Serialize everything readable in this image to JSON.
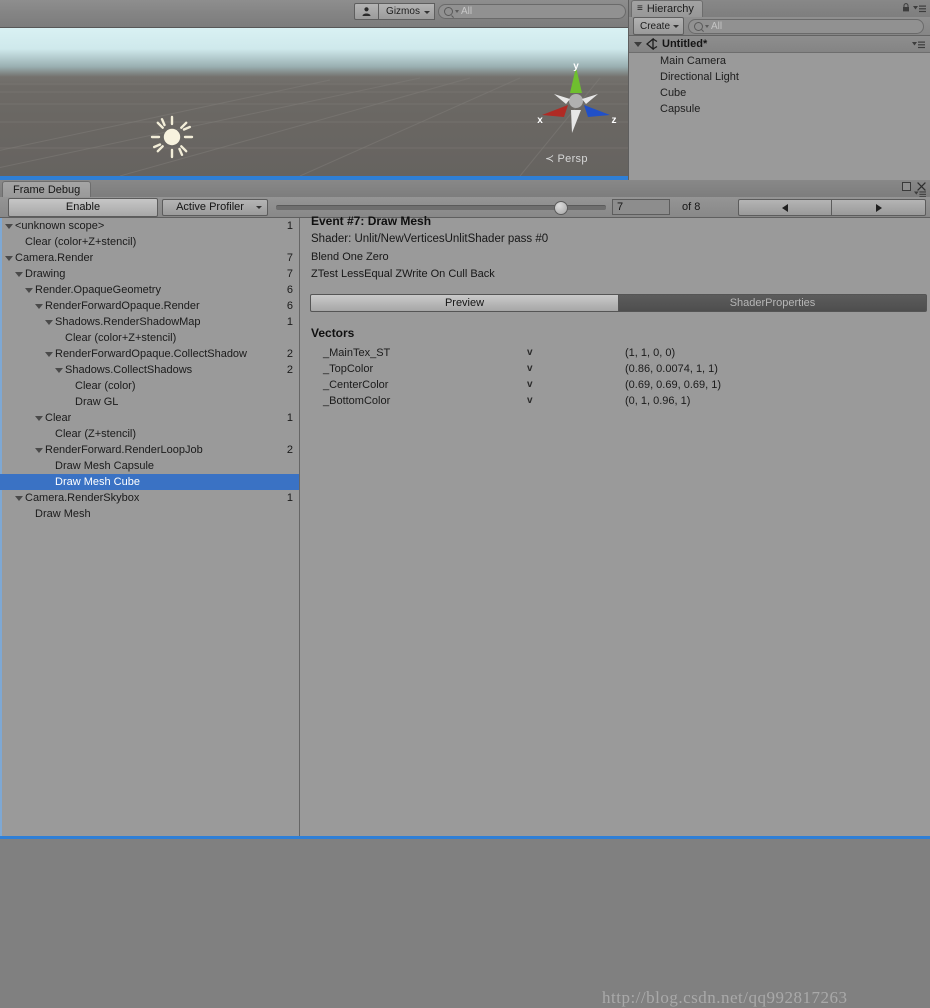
{
  "scene_view": {
    "toolbar": {
      "person_icon": "person-icon",
      "gizmos_label": "Gizmos",
      "search_placeholder": "All",
      "search_value": "All"
    },
    "gizmo": {
      "axis_x": "x",
      "axis_y": "y",
      "axis_z": "z",
      "projection_label": "Persp",
      "color_x": "#b02a24",
      "color_y": "#6fbf2f",
      "color_z": "#2050c8"
    },
    "light_icon": "sun-light-gizmo-icon"
  },
  "hierarchy": {
    "tab_label": "Hierarchy",
    "tab_icon": "hierarchy-icon",
    "create_label": "Create",
    "search_placeholder": "All",
    "search_value": "All",
    "scene_root": "Untitled*",
    "items": [
      {
        "label": "Main Camera"
      },
      {
        "label": "Directional Light"
      },
      {
        "label": "Cube"
      },
      {
        "label": "Capsule"
      }
    ]
  },
  "frame_debug": {
    "tab_label": "Frame Debug",
    "toolbar": {
      "enable_label": "Enable",
      "profiler_label": "Active Profiler",
      "event_number": "7",
      "of_label": "of 8",
      "slider_value": 7,
      "slider_max": 8
    },
    "tree": [
      {
        "label": "<unknown scope>",
        "indent": 0,
        "arrow": true,
        "count": "1",
        "selected": false
      },
      {
        "label": "Clear (color+Z+stencil)",
        "indent": 1,
        "arrow": false,
        "count": "",
        "selected": false
      },
      {
        "label": "Camera.Render",
        "indent": 0,
        "arrow": true,
        "count": "7",
        "selected": false
      },
      {
        "label": "Drawing",
        "indent": 1,
        "arrow": true,
        "count": "7",
        "selected": false
      },
      {
        "label": "Render.OpaqueGeometry",
        "indent": 2,
        "arrow": true,
        "count": "6",
        "selected": false
      },
      {
        "label": "RenderForwardOpaque.Render",
        "indent": 3,
        "arrow": true,
        "count": "6",
        "selected": false
      },
      {
        "label": "Shadows.RenderShadowMap",
        "indent": 4,
        "arrow": true,
        "count": "1",
        "selected": false
      },
      {
        "label": "Clear (color+Z+stencil)",
        "indent": 5,
        "arrow": false,
        "count": "",
        "selected": false
      },
      {
        "label": "RenderForwardOpaque.CollectShadow",
        "indent": 4,
        "arrow": true,
        "count": "2",
        "selected": false
      },
      {
        "label": "Shadows.CollectShadows",
        "indent": 5,
        "arrow": true,
        "count": "2",
        "selected": false
      },
      {
        "label": "Clear (color)",
        "indent": 6,
        "arrow": false,
        "count": "",
        "selected": false
      },
      {
        "label": "Draw GL",
        "indent": 6,
        "arrow": false,
        "count": "",
        "selected": false
      },
      {
        "label": "Clear",
        "indent": 3,
        "arrow": true,
        "count": "1",
        "selected": false
      },
      {
        "label": "Clear (Z+stencil)",
        "indent": 4,
        "arrow": false,
        "count": "",
        "selected": false
      },
      {
        "label": "RenderForward.RenderLoopJob",
        "indent": 3,
        "arrow": true,
        "count": "2",
        "selected": false
      },
      {
        "label": "Draw Mesh Capsule",
        "indent": 4,
        "arrow": false,
        "count": "",
        "selected": false
      },
      {
        "label": "Draw Mesh Cube",
        "indent": 4,
        "arrow": false,
        "count": "",
        "selected": true
      },
      {
        "label": "Camera.RenderSkybox",
        "indent": 1,
        "arrow": true,
        "count": "1",
        "selected": false
      },
      {
        "label": "Draw Mesh",
        "indent": 2,
        "arrow": false,
        "count": "",
        "selected": false
      }
    ],
    "detail": {
      "event_title": "Event #7: Draw Mesh",
      "shader_line": "Shader: Unlit/NewVerticesUnlitShader pass #0",
      "blend_line": "Blend One Zero",
      "ztest_line": "ZTest LessEqual ZWrite On Cull Back",
      "tab_preview": "Preview",
      "tab_shader_properties": "ShaderProperties",
      "vectors_header": "Vectors",
      "vectors": [
        {
          "name": "_MainTex_ST",
          "type": "v",
          "value": "(1, 1, 0, 0)"
        },
        {
          "name": "_TopColor",
          "type": "v",
          "value": "(0.86, 0.0074, 1, 1)"
        },
        {
          "name": "_CenterColor",
          "type": "v",
          "value": "(0.69, 0.69, 0.69, 1)"
        },
        {
          "name": "_BottomColor",
          "type": "v",
          "value": "(0, 1, 0.96, 1)"
        }
      ]
    }
  },
  "watermark": "http://blog.csdn.net/qq992817263",
  "colors": {
    "selection_blue": "#3a72c4",
    "panel_gray": "#9a9a9a",
    "accent_bar": "#2f7fd6"
  }
}
